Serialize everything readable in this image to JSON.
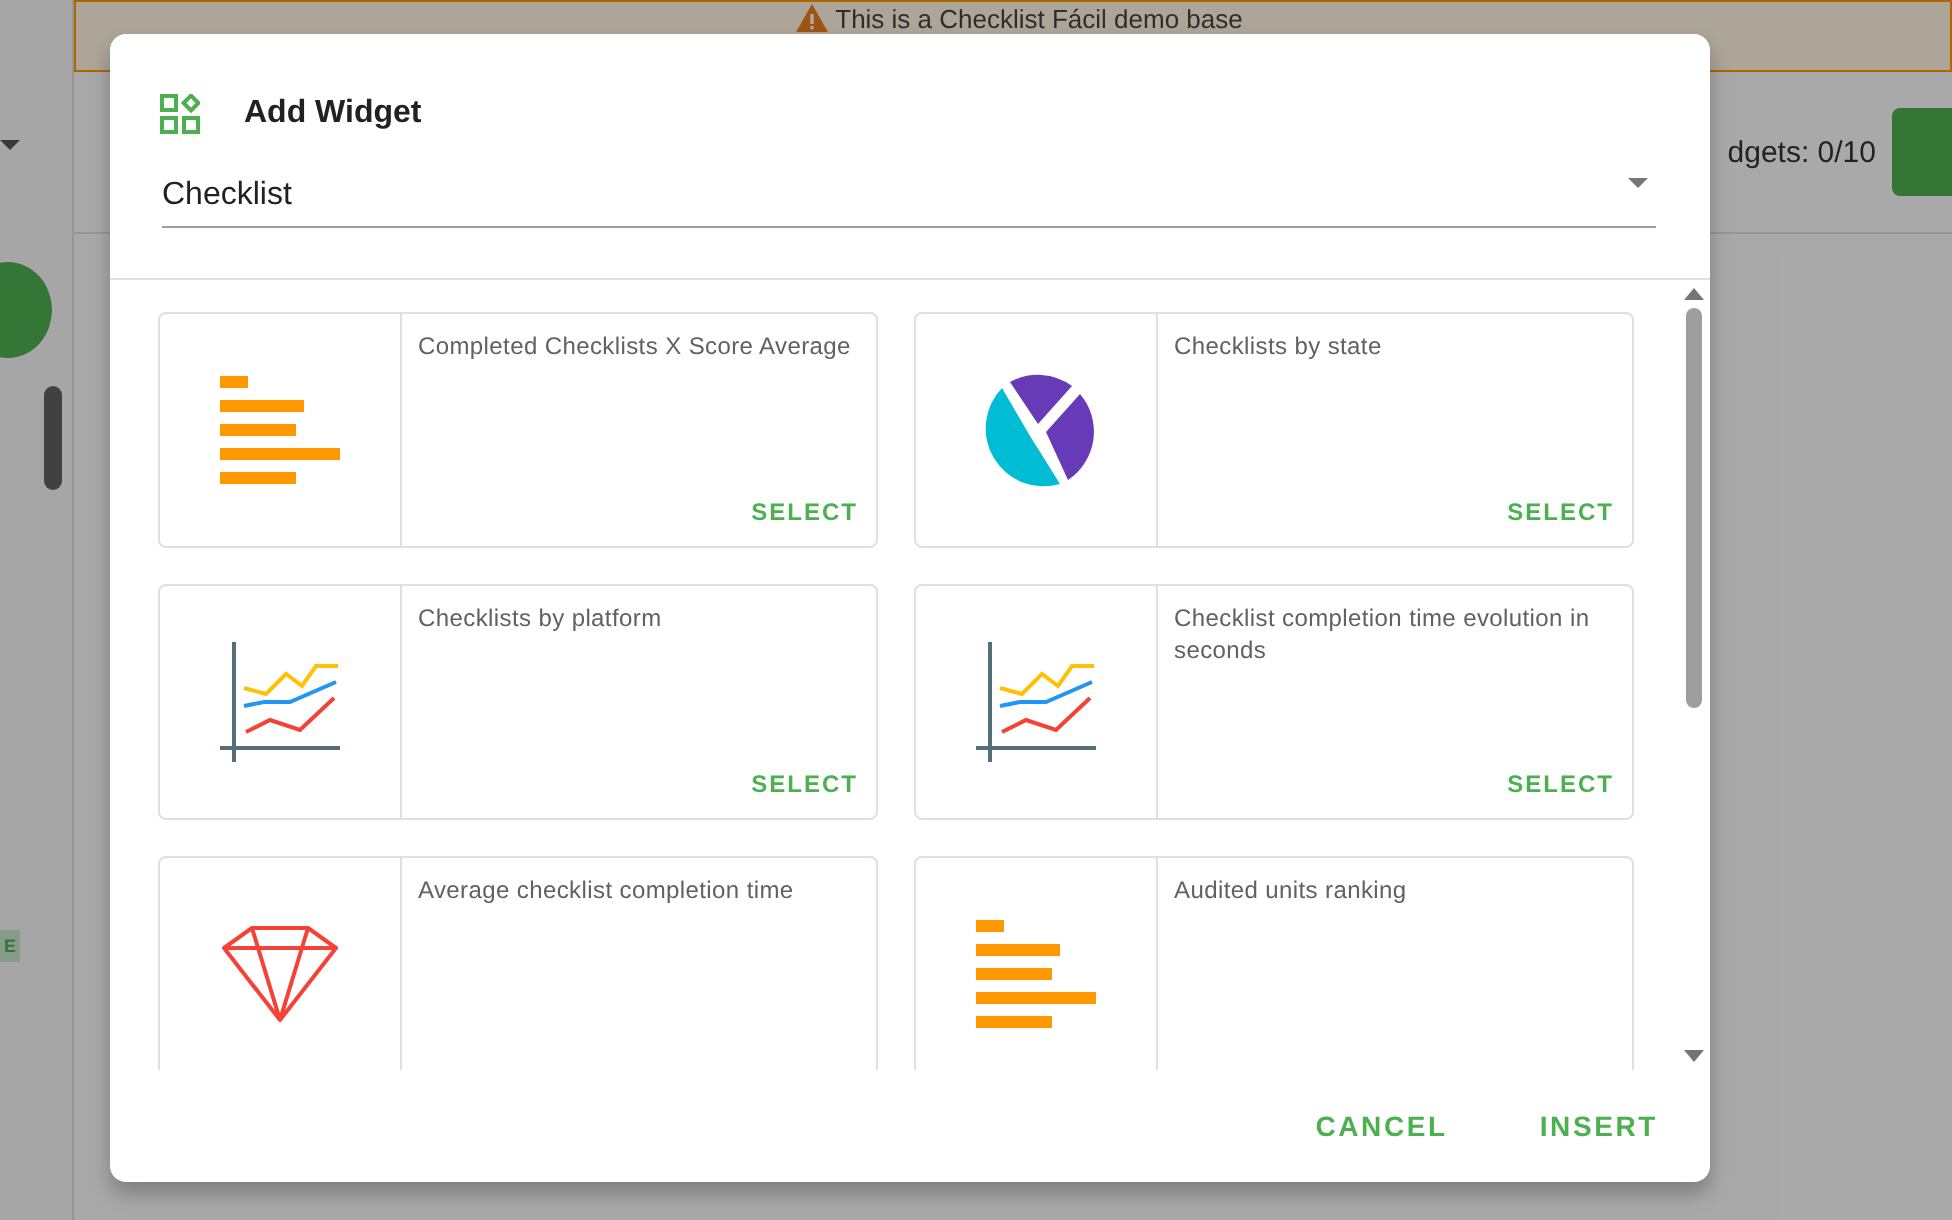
{
  "background": {
    "banner": {
      "text": "This is a Checklist Fácil demo base"
    },
    "widget_count": "dgets: 0/10",
    "sidebar_badge": "E"
  },
  "dialog": {
    "title": "Add Widget",
    "category_select": {
      "value": "Checklist"
    },
    "widgets": [
      {
        "title": "Completed Checklists X Score Average",
        "kind": "bar",
        "action": "SELECT"
      },
      {
        "title": "Checklists by state",
        "kind": "pie",
        "action": "SELECT"
      },
      {
        "title": "Checklists by platform",
        "kind": "line",
        "action": "SELECT"
      },
      {
        "title": "Checklist completion time evolution in seconds",
        "kind": "line",
        "action": "SELECT"
      },
      {
        "title": "Average checklist completion time",
        "kind": "gem"
      },
      {
        "title": "Audited units ranking",
        "kind": "bar"
      }
    ],
    "buttons": [
      {
        "label": "CANCEL"
      },
      {
        "label": "INSERT"
      }
    ]
  }
}
